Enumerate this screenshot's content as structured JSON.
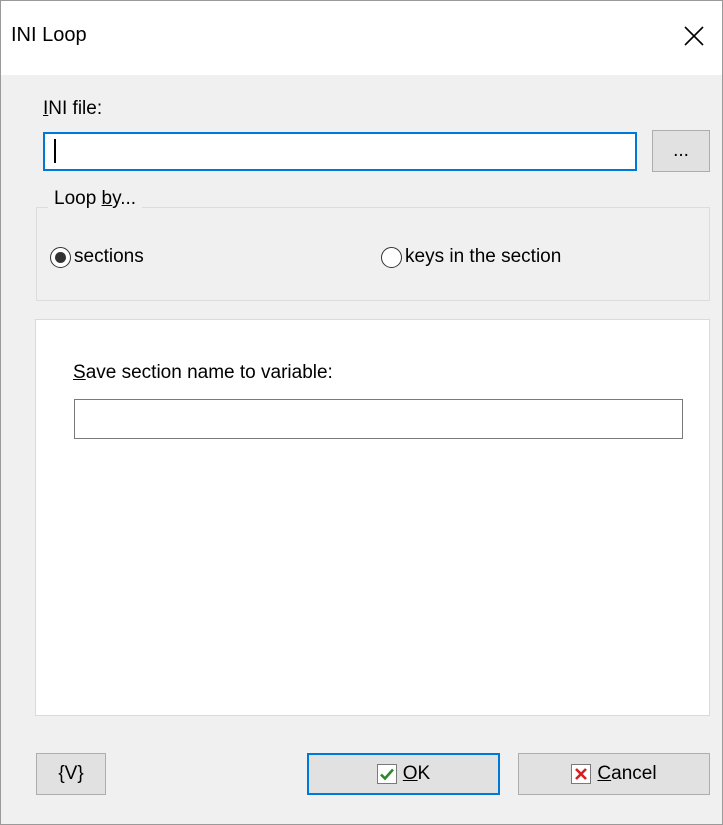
{
  "window": {
    "title": "INI Loop"
  },
  "ini_file": {
    "label_prefix": "",
    "label_hotkey": "I",
    "label_rest": "NI file:",
    "value": "",
    "browse_label": "..."
  },
  "loop_by": {
    "legend_prefix": "Loop ",
    "legend_hotkey": "b",
    "legend_rest": "y...",
    "options": [
      {
        "label": "sections",
        "selected": true
      },
      {
        "label": "keys in the section",
        "selected": false
      }
    ]
  },
  "save_variable": {
    "label_hotkey": "S",
    "label_rest": "ave section name to variable:",
    "value": ""
  },
  "buttons": {
    "variables": "{V}",
    "ok_hotkey": "O",
    "ok_rest": "K",
    "cancel_hotkey": "C",
    "cancel_rest": "ancel"
  },
  "colors": {
    "accent": "#0078d7",
    "ok_check": "#2a8a2a",
    "cancel_x": "#d42020"
  },
  "icons": {
    "close": "close-icon",
    "ok": "checkmark-icon",
    "cancel": "x-mark-icon"
  }
}
